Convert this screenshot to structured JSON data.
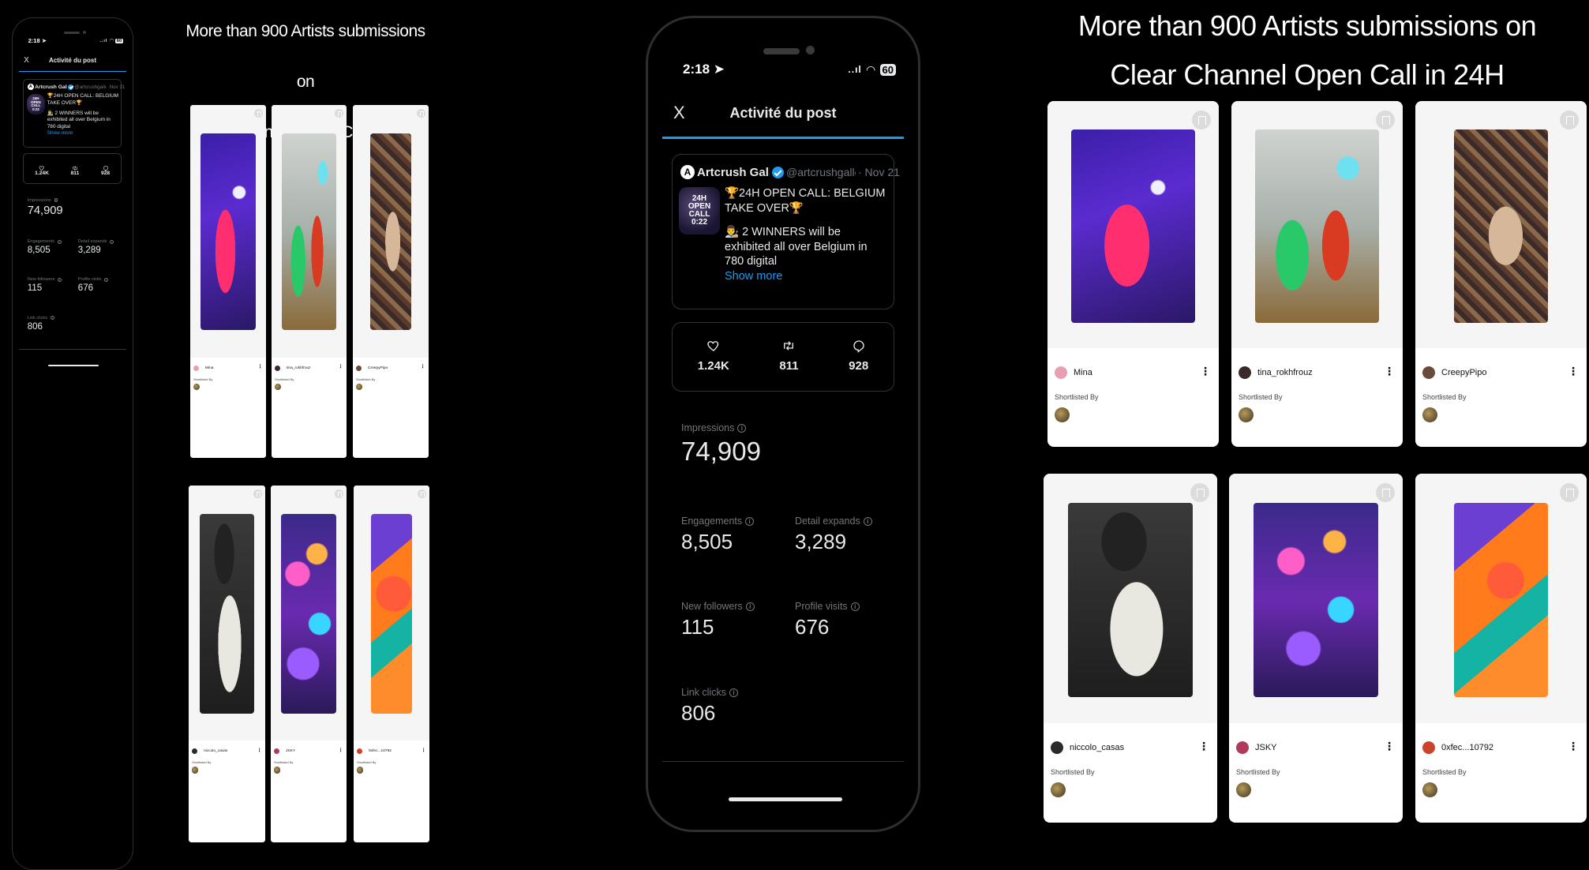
{
  "heading": {
    "line1": "More than 900 Artists submissions on",
    "line2": "Clear Channel Open Call in 24H"
  },
  "phone": {
    "time": "2:18",
    "battery": "60",
    "nav_close": "X",
    "nav_title": "Activité du post",
    "post": {
      "avatar_letter": "A",
      "name": "Artcrush Gallery",
      "handle": "@artcrushgaller",
      "date": "· Nov 21",
      "thumb_lines": [
        "24H",
        "OPEN",
        "CALL",
        "0:22"
      ],
      "line1": "🏆24H OPEN CALL: BELGIUM TAKE OVER🏆",
      "line2": "👨‍🎨 2 WINNERS will be exhibited all over Belgium in 780 digital",
      "show_more": "Show more"
    },
    "engagement": {
      "likes": "1.24K",
      "retweets": "811",
      "replies": "928"
    },
    "stats": {
      "impressions_label": "Impressions",
      "impressions": "74,909",
      "engagements_label": "Engagements",
      "engagements": "8,505",
      "detail_label": "Detail expands",
      "detail": "3,289",
      "followers_label": "New followers",
      "followers": "115",
      "profile_label": "Profile visits",
      "profile": "676",
      "link_label": "Link clicks",
      "link": "806"
    }
  },
  "artworks": [
    {
      "artist": "Mina",
      "shortlisted": "Shortlisted By",
      "avatar_color": "#e8a0b0"
    },
    {
      "artist": "tina_rokhfrouz",
      "shortlisted": "Shortlisted By",
      "avatar_color": "#3a2a2a"
    },
    {
      "artist": "CreepyPipo",
      "shortlisted": "Shortlisted By",
      "avatar_color": "#6a4a3a"
    },
    {
      "artist": "niccolo_casas",
      "shortlisted": "Shortlisted By",
      "avatar_color": "#2a2a2a"
    },
    {
      "artist": "JSKY",
      "shortlisted": "Shortlisted By",
      "avatar_color": "#b03a5a"
    },
    {
      "artist": "0xfec...10792",
      "shortlisted": "Shortlisted By",
      "avatar_color": "#c8442a"
    }
  ],
  "icons": {
    "like": "heart-icon",
    "retweet": "retweet-icon",
    "reply": "reply-icon",
    "bookmark": "bookmark-icon",
    "more": "kebab-menu-icon"
  },
  "colors": {
    "accent": "#1d9bf0",
    "background": "#000000",
    "muted": "#71767b"
  }
}
